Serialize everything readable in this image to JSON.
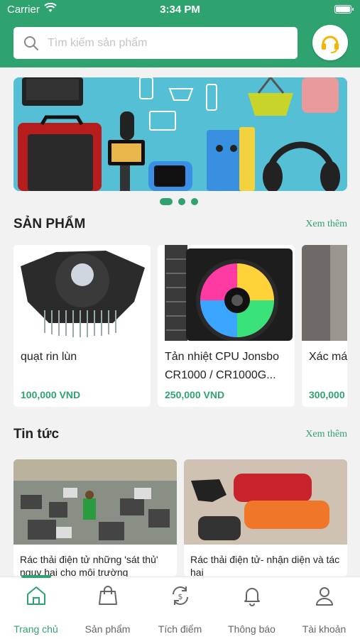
{
  "status_bar": {
    "carrier": "Carrier",
    "time": "3:34 PM"
  },
  "search": {
    "placeholder": "Tìm kiếm sản phẩm"
  },
  "colors": {
    "brand": "#2fa36f"
  },
  "banner": {
    "slide_count": 3,
    "active_slide": 1
  },
  "products_section": {
    "title": "SẢN PHẨM",
    "see_more": "Xem thêm"
  },
  "products": [
    {
      "name": "quạt rin lùn",
      "price": "100,000 VND"
    },
    {
      "name": "Tản nhiệt CPU Jonsbo CR1000 / CR1000G...",
      "price": "250,000 VND"
    },
    {
      "name": "Xác má",
      "price": "300,000"
    }
  ],
  "news_section": {
    "title": "Tin tức",
    "see_more": "Xem thêm"
  },
  "news": [
    {
      "title": "Rác thải điện tử những 'sát thủ' nguy hại cho môi trường"
    },
    {
      "title": "Rác thải điện tử- nhận diện và tác hại"
    }
  ],
  "tabbar": [
    {
      "label": "Trang chủ",
      "icon": "home-icon",
      "active": true
    },
    {
      "label": "Sản phẩm",
      "icon": "shopping-bag-icon"
    },
    {
      "label": "Tích điểm",
      "icon": "points-exchange-icon"
    },
    {
      "label": "Thông báo",
      "icon": "bell-icon"
    },
    {
      "label": "Tài khoản",
      "icon": "user-icon"
    }
  ]
}
